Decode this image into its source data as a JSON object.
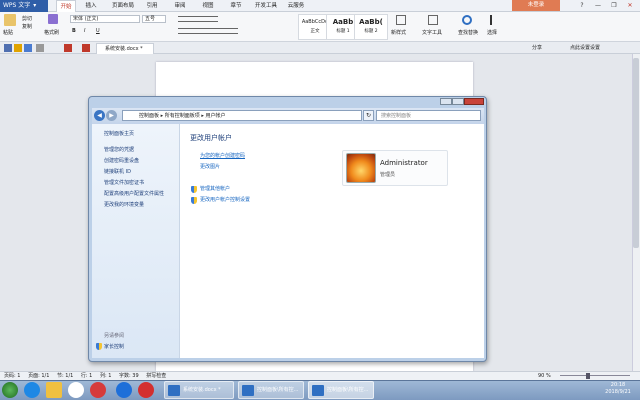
{
  "app": {
    "title": "WPS 文字",
    "dropdown": "▾"
  },
  "tabs": [
    "开始",
    "插入",
    "页面布局",
    "引用",
    "审阅",
    "视图",
    "章节",
    "开发工具",
    "云服务"
  ],
  "login": "未登录",
  "window_controls": [
    "?",
    "—",
    "❐",
    "✕"
  ],
  "ribbon": {
    "paste": "粘贴",
    "cut": "剪切",
    "copy": "复制",
    "format_painter": "格式刷",
    "font_name": "宋体 (正文)",
    "font_size": "五号",
    "bold": "B",
    "italic": "I",
    "underline": "U",
    "styles": [
      {
        "sample": "AaBbCcDd",
        "label": "正文"
      },
      {
        "sample": "AaBb",
        "label": "标题 1"
      },
      {
        "sample": "AaBb(",
        "label": "标题 2"
      }
    ],
    "new_style": "新样式",
    "text_tools": "文字工具",
    "find_replace": "查找替换",
    "select": "选择",
    "share": "分享",
    "help_comment": "点此设置设置"
  },
  "doc_tab": {
    "name": "系统安装.docx *"
  },
  "control_panel": {
    "breadcrumb": [
      "控制面板",
      "所有控制面板项",
      "用户帐户"
    ],
    "search_placeholder": "搜索控制面板",
    "left_title": "控制面板主页",
    "left_links": [
      "管理您的凭据",
      "创建密码重设盘",
      "链接联机 ID",
      "管理文件加密证书",
      "配置高级用户配置文件属性",
      "更改我的环境变量"
    ],
    "see_also": "另请参阅",
    "parental": "家长控制",
    "main_title": "更改用户帐户",
    "links": [
      "为您的帐户创建密码",
      "更改图片"
    ],
    "shield_links": [
      "管理其他帐户",
      "更改用户帐户控制设置"
    ],
    "account": {
      "name": "Administrator",
      "role": "管理员"
    }
  },
  "status": {
    "page": "页码: 1",
    "pages": "页面: 1/1",
    "section": "节: 1/1",
    "row": "行: 1",
    "col": "列: 1",
    "words": "字数: 39",
    "spell": "拼写检查",
    "zoom": "90 %"
  },
  "taskbar": {
    "tasks": [
      "系统安装.docx *",
      "控制面板\\所有控...",
      "控制面板\\所有控..."
    ],
    "time": "20:18",
    "date": "2018/9/21"
  }
}
